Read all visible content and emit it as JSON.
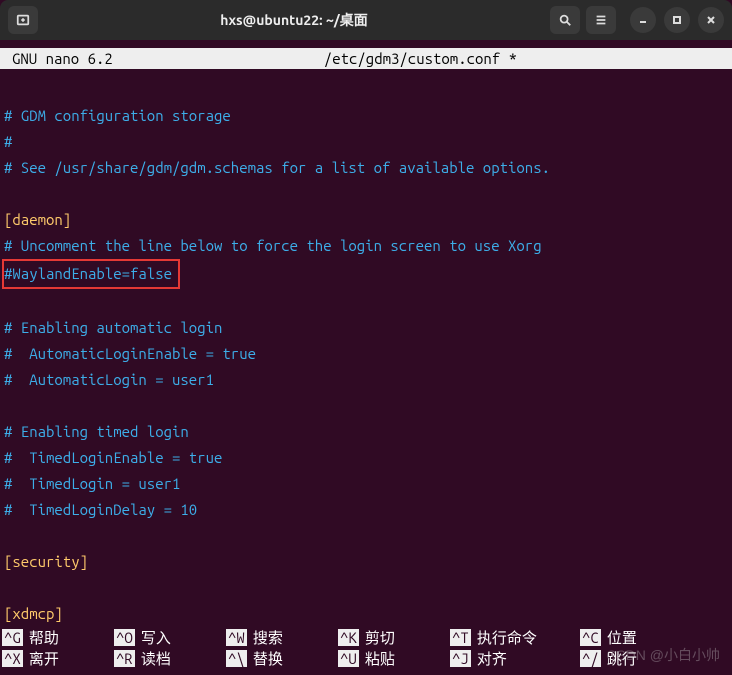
{
  "window": {
    "title": "hxs@ubuntu22: ~/桌面"
  },
  "editor": {
    "name": "GNU nano 6.2",
    "file": "/etc/gdm3/custom.conf *"
  },
  "lines": {
    "l1": "# GDM configuration storage",
    "l2": "#",
    "l3": "# See /usr/share/gdm/gdm.schemas for a list of available options.",
    "l4": "[daemon]",
    "l5": "# Uncomment the line below to force the login screen to use Xorg",
    "l6": "#WaylandEnable=false",
    "l7": "# Enabling automatic login",
    "l8": "#  AutomaticLoginEnable = true",
    "l9": "#  AutomaticLogin = user1",
    "l10": "# Enabling timed login",
    "l11": "#  TimedLoginEnable = true",
    "l12": "#  TimedLogin = user1",
    "l13": "#  TimedLoginDelay = 10",
    "l14": "[security]",
    "l15": "[xdmcp]"
  },
  "help": {
    "r1": [
      {
        "key": "^G",
        "label": "帮助"
      },
      {
        "key": "^O",
        "label": "写入"
      },
      {
        "key": "^W",
        "label": "搜索"
      },
      {
        "key": "^K",
        "label": "剪切"
      },
      {
        "key": "^T",
        "label": "执行命令"
      },
      {
        "key": "^C",
        "label": "位置"
      }
    ],
    "r2": [
      {
        "key": "^X",
        "label": "离开"
      },
      {
        "key": "^R",
        "label": "读档"
      },
      {
        "key": "^\\",
        "label": "替换"
      },
      {
        "key": "^U",
        "label": "粘贴"
      },
      {
        "key": "^J",
        "label": "对齐"
      },
      {
        "key": "^/",
        "label": "跳行"
      }
    ]
  },
  "watermark": "CSDN @小白小帅"
}
